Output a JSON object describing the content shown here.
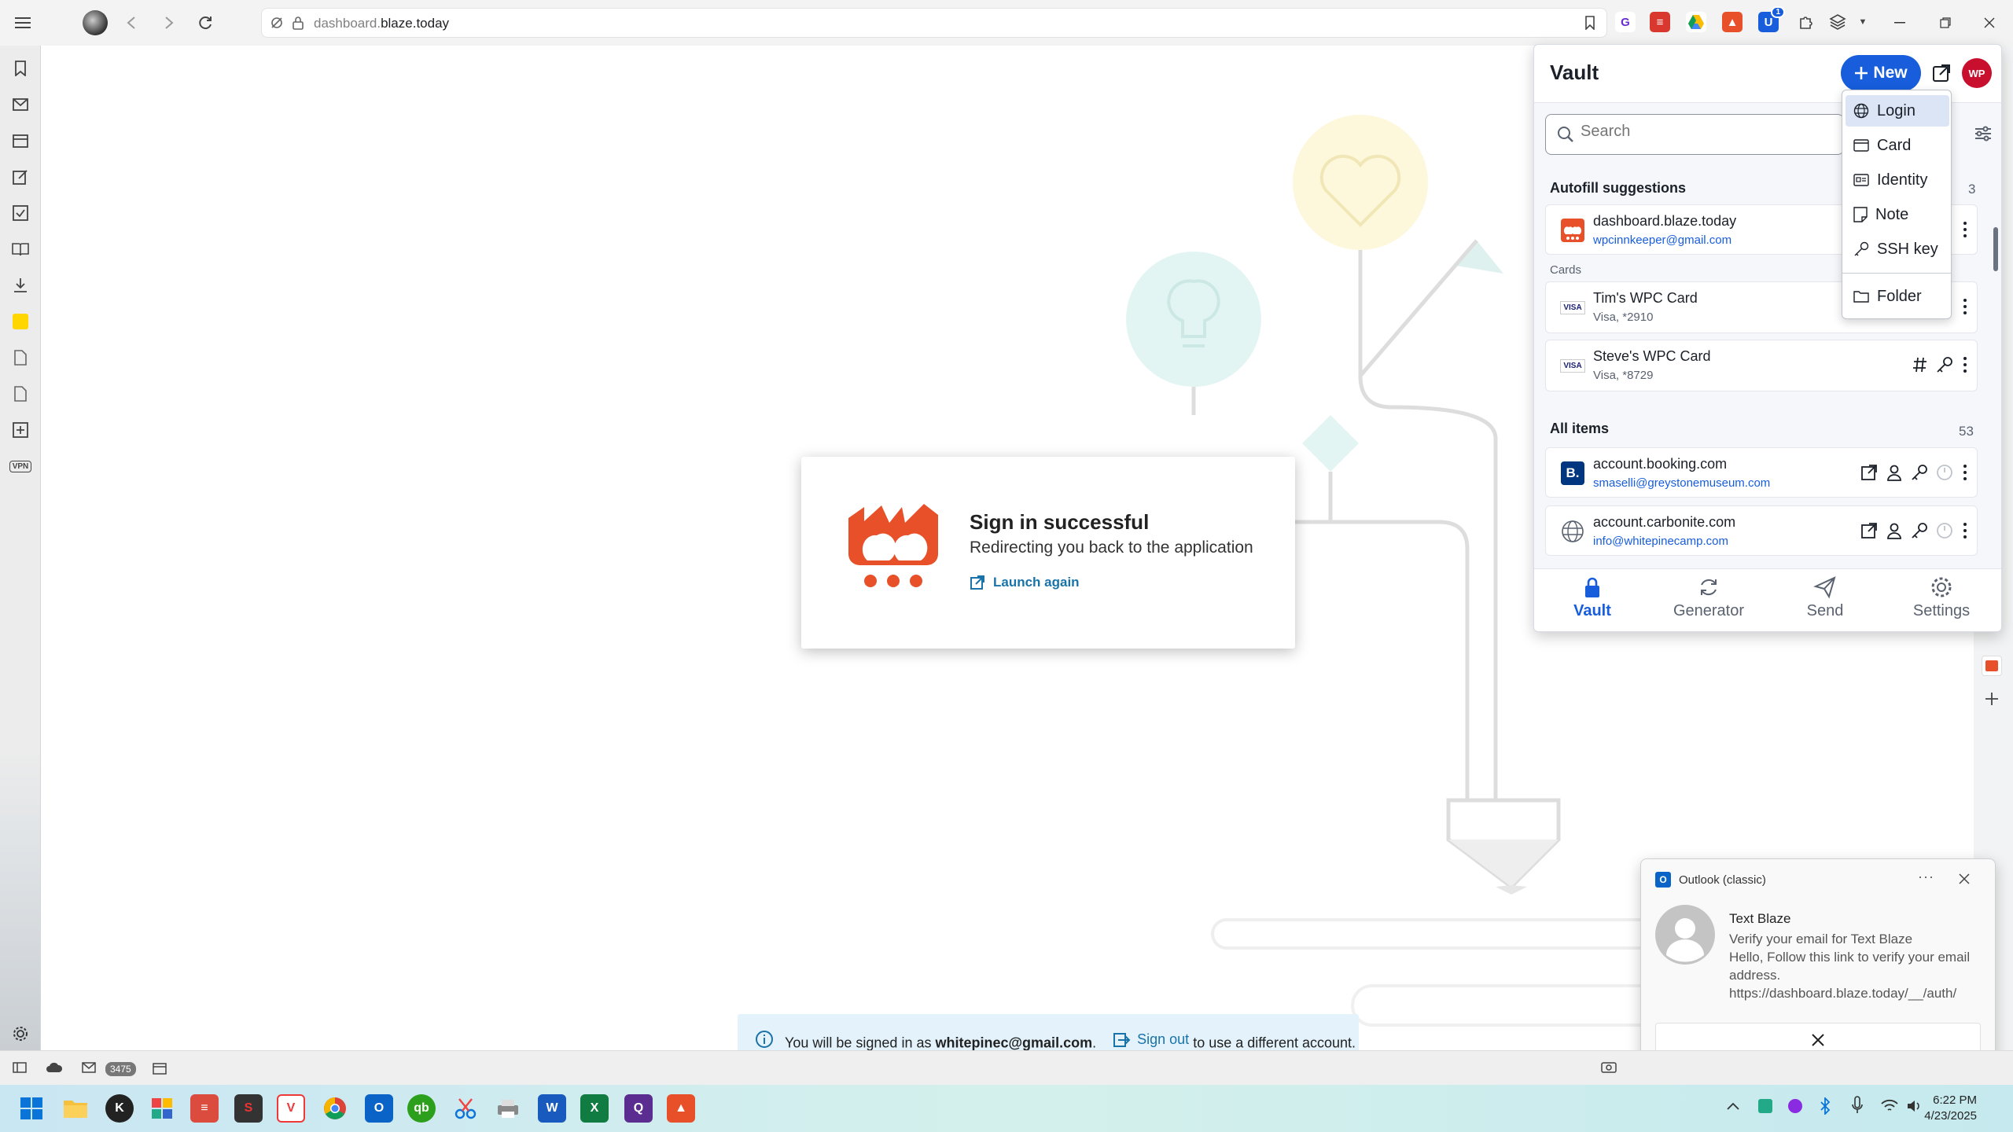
{
  "browser": {
    "url_host_prefix": "dashboard.",
    "url_host_main": "blaze.today",
    "extension_badge": "1"
  },
  "page": {
    "signin_title": "Sign in successful",
    "signin_subtitle": "Redirecting you back to the application",
    "launch_again": "Launch again",
    "banner_prefix": "You will be signed in as",
    "banner_email": "whitepinec@gmail.com",
    "banner_period": ".",
    "banner_signout": "Sign out",
    "banner_suffix": "to use a different account."
  },
  "vault": {
    "title": "Vault",
    "new_label": "New",
    "avatar_initials": "WP",
    "search_placeholder": "Search",
    "autofill_title": "Autofill suggestions",
    "autofill_count": "3",
    "autofill_items": [
      {
        "name": "dashboard.blaze.today",
        "sub": "wpcinnkeeper@gmail.com"
      }
    ],
    "cards_title": "Cards",
    "cards": [
      {
        "name": "Tim's WPC Card",
        "sub": "Visa, *2910",
        "brand": "VISA"
      },
      {
        "name": "Steve's WPC Card",
        "sub": "Visa, *8729",
        "brand": "VISA"
      }
    ],
    "all_title": "All items",
    "all_count": "53",
    "all_items": [
      {
        "name": "account.booking.com",
        "sub": "smaselli@greystonemuseum.com",
        "icon_letter": "B."
      },
      {
        "name": "account.carbonite.com",
        "sub": "info@whitepinecamp.com"
      }
    ],
    "nav": [
      {
        "label": "Vault",
        "icon": "lock-icon",
        "active": true
      },
      {
        "label": "Generator",
        "icon": "refresh-icon"
      },
      {
        "label": "Send",
        "icon": "send-icon"
      },
      {
        "label": "Settings",
        "icon": "gear-icon"
      }
    ],
    "accent_color": "#175ddc"
  },
  "new_menu": {
    "items": [
      "Login",
      "Card",
      "Identity",
      "Note",
      "SSH key"
    ],
    "folder": "Folder"
  },
  "toast": {
    "app": "Outlook (classic)",
    "sender": "Text Blaze",
    "body": "Verify your email for Text Blaze\nHello,  Follow this link to verify your email address.\nhttps://dashboard.blaze.today/__/auth/"
  },
  "status": {
    "mail_count": "3475"
  },
  "taskbar": {
    "time": "6:22 PM",
    "date": "4/23/2025"
  }
}
